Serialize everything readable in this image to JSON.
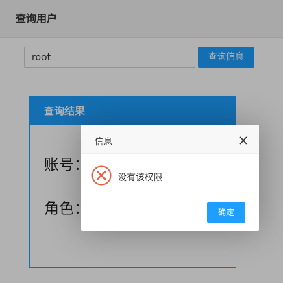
{
  "header": {
    "title": "查询用户"
  },
  "search": {
    "value": "root",
    "button_label": "查询信息"
  },
  "result": {
    "title": "查询结果",
    "lines": [
      "账号：",
      "角色："
    ]
  },
  "dialog": {
    "title": "信息",
    "message": "没有该权限",
    "ok_label": "确定",
    "icon": "error-circle-icon",
    "close_icon": "close-icon"
  },
  "colors": {
    "accent": "#1e9fff",
    "error": "#e85c3f",
    "header_bg": "#f2f2f2"
  }
}
